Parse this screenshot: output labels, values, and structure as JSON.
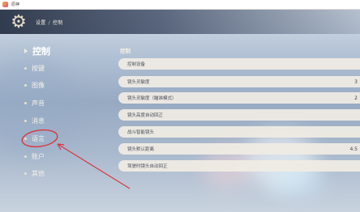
{
  "window": {
    "title": "原神"
  },
  "header": {
    "icon": "gear-icon",
    "breadcrumb": [
      "设置",
      "控制"
    ]
  },
  "sidebar": {
    "items": [
      {
        "label": "控制",
        "active": true
      },
      {
        "label": "按键",
        "active": false
      },
      {
        "label": "图像",
        "active": false
      },
      {
        "label": "声音",
        "active": false
      },
      {
        "label": "消息",
        "active": false
      },
      {
        "label": "语言",
        "active": false
      },
      {
        "label": "账户",
        "active": false
      },
      {
        "label": "其他",
        "active": false
      }
    ]
  },
  "panel": {
    "title": "控制",
    "rows": [
      {
        "label": "控制设备",
        "value": ""
      },
      {
        "label": "镜头灵敏度",
        "value": "3"
      },
      {
        "label": "镜头灵敏度（瞄准模式）",
        "value": "2"
      },
      {
        "label": "镜头高度自动回正",
        "value": ""
      },
      {
        "label": "战斗智能镜头",
        "value": ""
      },
      {
        "label": "镜头默认距离",
        "value": "4.5"
      },
      {
        "label": "驾驶时镜头自动回正",
        "value": ""
      }
    ]
  },
  "colors": {
    "annotation": "#d9363e",
    "row_bg": "#f0ece4",
    "text_light": "#f4f1ea"
  }
}
